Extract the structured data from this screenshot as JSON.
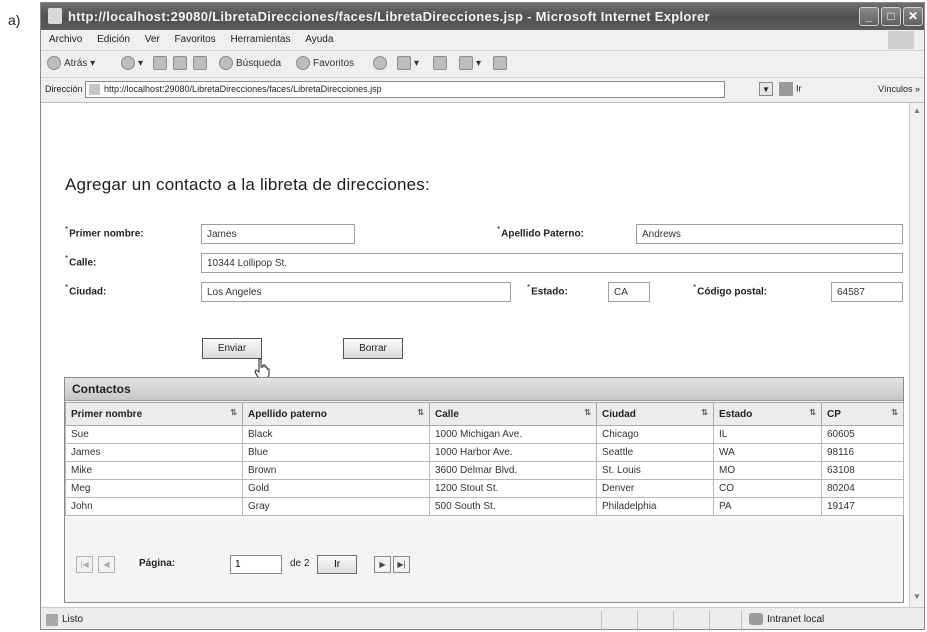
{
  "figure_label": "a)",
  "window": {
    "title": "http://localhost:29080/LibretaDirecciones/faces/LibretaDirecciones.jsp - Microsoft Internet Explorer"
  },
  "menu": [
    "Archivo",
    "Edición",
    "Ver",
    "Favoritos",
    "Herramientas",
    "Ayuda"
  ],
  "toolbar": {
    "back_label": "Atrás",
    "search_label": "Búsqueda",
    "favorites_label": "Favoritos"
  },
  "address": {
    "label": "Dirección",
    "url": "http://localhost:29080/LibretaDirecciones/faces/LibretaDirecciones.jsp",
    "go_label": "Ir",
    "links_label": "Vínculos"
  },
  "form": {
    "heading": "Agregar un contacto a la libreta de direcciones:",
    "required_marker": "*",
    "first_name_label": "Primer nombre:",
    "first_name_value": "James",
    "last_name_label": "Apellido Paterno:",
    "last_name_value": "Andrews",
    "street_label": "Calle:",
    "street_value": "10344 Lollipop St.",
    "city_label": "Ciudad:",
    "city_value": "Los Angeles",
    "state_label": "Estado:",
    "state_value": "CA",
    "zip_label": "Código postal:",
    "zip_value": "64587",
    "submit_label": "Enviar",
    "clear_label": "Borrar"
  },
  "contacts": {
    "title": "Contactos",
    "columns": [
      "Primer nombre",
      "Apellido paterno",
      "Calle",
      "Ciudad",
      "Estado",
      "CP"
    ],
    "rows": [
      [
        "Sue",
        "Black",
        "1000 Michigan Ave.",
        "Chicago",
        "IL",
        "60605"
      ],
      [
        "James",
        "Blue",
        "1000 Harbor Ave.",
        "Seattle",
        "WA",
        "98116"
      ],
      [
        "Mike",
        "Brown",
        "3600 Delmar Blvd.",
        "St. Louis",
        "MO",
        "63108"
      ],
      [
        "Meg",
        "Gold",
        "1200 Stout St.",
        "Denver",
        "CO",
        "80204"
      ],
      [
        "John",
        "Gray",
        "500 South St.",
        "Philadelphia",
        "PA",
        "19147"
      ]
    ],
    "pager": {
      "page_label": "Página:",
      "page_value": "1",
      "of_label": "de 2",
      "go_label": "Ir"
    }
  },
  "status": {
    "text": "Listo",
    "zone": "Intranet local"
  }
}
